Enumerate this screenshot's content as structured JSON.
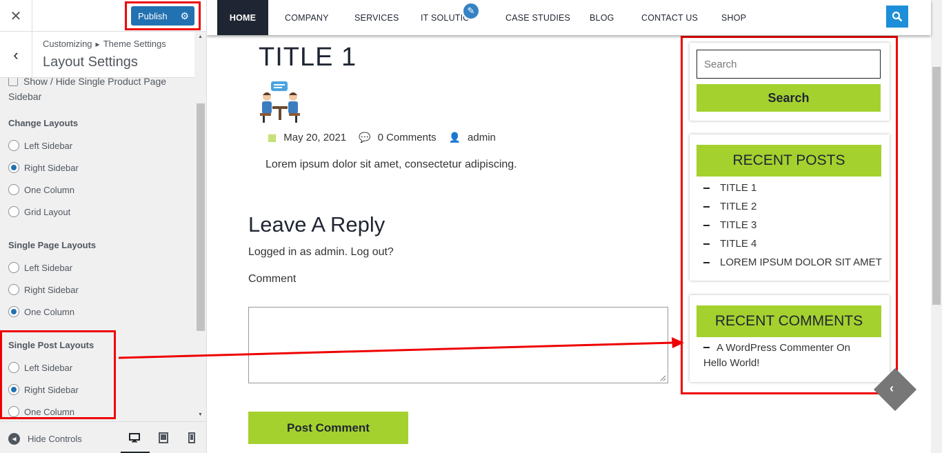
{
  "customizer": {
    "close_icon": "close-icon",
    "publish_label": "Publish",
    "settings_icon": "gear-icon",
    "breadcrumb_root": "Customizing",
    "breadcrumb_section": "Theme Settings",
    "section_title": "Layout Settings",
    "partial_option": "Show / Hide Single Product Page Sidebar",
    "groups": [
      {
        "title": "Change Layouts",
        "options": [
          {
            "label": "Left Sidebar",
            "selected": false
          },
          {
            "label": "Right Sidebar",
            "selected": true
          },
          {
            "label": "One Column",
            "selected": false
          },
          {
            "label": "Grid Layout",
            "selected": false
          }
        ]
      },
      {
        "title": "Single Page Layouts",
        "options": [
          {
            "label": "Left Sidebar",
            "selected": false
          },
          {
            "label": "Right Sidebar",
            "selected": false
          },
          {
            "label": "One Column",
            "selected": true
          }
        ]
      },
      {
        "title": "Single Post Layouts",
        "options": [
          {
            "label": "Left Sidebar",
            "selected": false
          },
          {
            "label": "Right Sidebar",
            "selected": true
          },
          {
            "label": "One Column",
            "selected": false
          }
        ]
      }
    ],
    "hide_controls_label": "Hide Controls",
    "devices": [
      "desktop-icon",
      "tablet-icon",
      "mobile-icon"
    ],
    "active_device": "desktop"
  },
  "nav": {
    "items": [
      "HOME",
      "COMPANY",
      "SERVICES",
      "IT SOLUTIO",
      "CASE STUDIES",
      "BLOG",
      "CONTACT US",
      "SHOP"
    ],
    "active": "HOME"
  },
  "post": {
    "title": "TITLE 1",
    "date": "May 20, 2021",
    "comments": "0 Comments",
    "author": "admin",
    "excerpt": "Lorem ipsum dolor sit amet, consectetur adipiscing."
  },
  "reply": {
    "title": "Leave A Reply",
    "logged_in": "Logged in as admin. Log out?",
    "comment_label": "Comment",
    "submit_label": "Post Comment"
  },
  "sidebar": {
    "search_placeholder": "Search",
    "search_button": "Search",
    "recent_posts_title": "RECENT POSTS",
    "recent_posts": [
      "TITLE 1",
      "TITLE 2",
      "TITLE 3",
      "TITLE 4",
      "LOREM IPSUM DOLOR SIT AMET"
    ],
    "recent_comments_title": "RECENT COMMENTS",
    "recent_comment": "A WordPress Commenter On Hello World!"
  },
  "colors": {
    "accent_green": "#a4d12e",
    "nav_dark": "#1f2532",
    "wp_blue": "#2271b1",
    "highlight_red": "#ee0000"
  }
}
